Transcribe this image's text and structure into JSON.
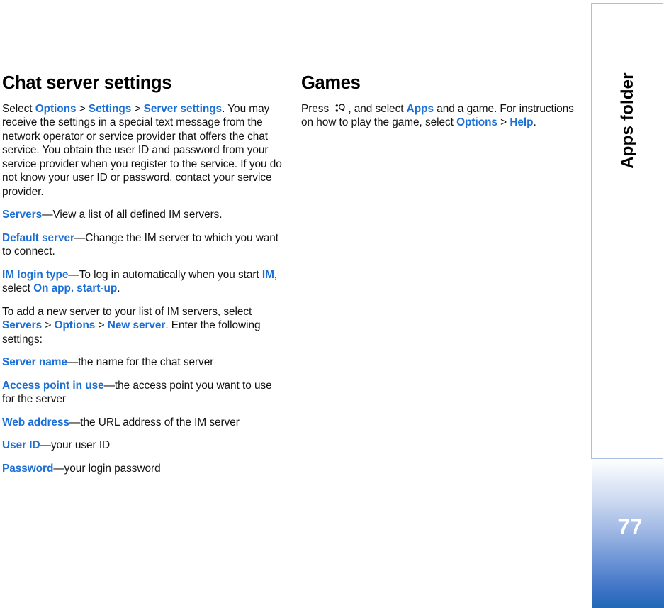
{
  "page": {
    "number": "77",
    "sidebar_label": "Apps folder",
    "accent_blue": "#1c6fd4",
    "sidebar_border": "#aabfe4",
    "gradient_end": "#2168b8"
  },
  "left_column": {
    "heading": "Chat server settings",
    "paragraphs": [
      {
        "id": "intro",
        "runs": [
          {
            "t": "Select ",
            "s": "plain"
          },
          {
            "t": "Options",
            "s": "link"
          },
          {
            "t": " > ",
            "s": "plain"
          },
          {
            "t": "Settings",
            "s": "link"
          },
          {
            "t": " > ",
            "s": "plain"
          },
          {
            "t": "Server settings",
            "s": "link"
          },
          {
            "t": ". You may receive the settings in a special text message from the network operator or service provider that offers the chat service. You obtain the user ID and password from your service provider when you register to the service. If you do not know your user ID or password, contact your service provider.",
            "s": "plain"
          }
        ]
      },
      {
        "id": "servers",
        "runs": [
          {
            "t": "Servers",
            "s": "link"
          },
          {
            "t": "—View a list of all defined IM servers.",
            "s": "plain"
          }
        ]
      },
      {
        "id": "default-server",
        "runs": [
          {
            "t": "Default server",
            "s": "link"
          },
          {
            "t": "—Change the IM server to which you want to connect.",
            "s": "plain"
          }
        ]
      },
      {
        "id": "im-login-type",
        "runs": [
          {
            "t": "IM login type",
            "s": "link"
          },
          {
            "t": "—To log in automatically when you start ",
            "s": "plain"
          },
          {
            "t": "IM",
            "s": "link"
          },
          {
            "t": ", select ",
            "s": "plain"
          },
          {
            "t": "On app. start-up",
            "s": "link"
          },
          {
            "t": ".",
            "s": "plain"
          }
        ]
      },
      {
        "id": "add-new-server",
        "runs": [
          {
            "t": "To add a new server to your list of IM servers, select ",
            "s": "plain"
          },
          {
            "t": "Servers",
            "s": "link"
          },
          {
            "t": " > ",
            "s": "plain"
          },
          {
            "t": "Options",
            "s": "link"
          },
          {
            "t": " > ",
            "s": "plain"
          },
          {
            "t": "New server",
            "s": "link"
          },
          {
            "t": ". Enter the following settings:",
            "s": "plain"
          }
        ]
      },
      {
        "id": "server-name",
        "runs": [
          {
            "t": "Server name",
            "s": "link"
          },
          {
            "t": "—the name for the chat server",
            "s": "plain"
          }
        ]
      },
      {
        "id": "access-point-in-use",
        "runs": [
          {
            "t": "Access point in use",
            "s": "link"
          },
          {
            "t": "—the access point you want to use for the server",
            "s": "plain"
          }
        ]
      },
      {
        "id": "web-address",
        "runs": [
          {
            "t": "Web address",
            "s": "link"
          },
          {
            "t": "—the URL address of the IM server",
            "s": "plain"
          }
        ]
      },
      {
        "id": "user-id",
        "runs": [
          {
            "t": "User ID",
            "s": "link"
          },
          {
            "t": "—your user ID",
            "s": "plain"
          }
        ]
      },
      {
        "id": "password",
        "runs": [
          {
            "t": "Password",
            "s": "link"
          },
          {
            "t": "—your login password",
            "s": "plain"
          }
        ]
      }
    ]
  },
  "right_column": {
    "heading": "Games",
    "paragraphs": [
      {
        "id": "games-intro",
        "runs": [
          {
            "t": "Press ",
            "s": "plain"
          },
          {
            "t": "",
            "s": "menu-key-icon"
          },
          {
            "t": ", and select ",
            "s": "plain"
          },
          {
            "t": "Apps",
            "s": "link"
          },
          {
            "t": " and a game. For instructions on how to play the game, select ",
            "s": "plain"
          },
          {
            "t": "Options",
            "s": "link"
          },
          {
            "t": " > ",
            "s": "plain"
          },
          {
            "t": "Help",
            "s": "link"
          },
          {
            "t": ".",
            "s": "plain"
          }
        ]
      }
    ]
  }
}
